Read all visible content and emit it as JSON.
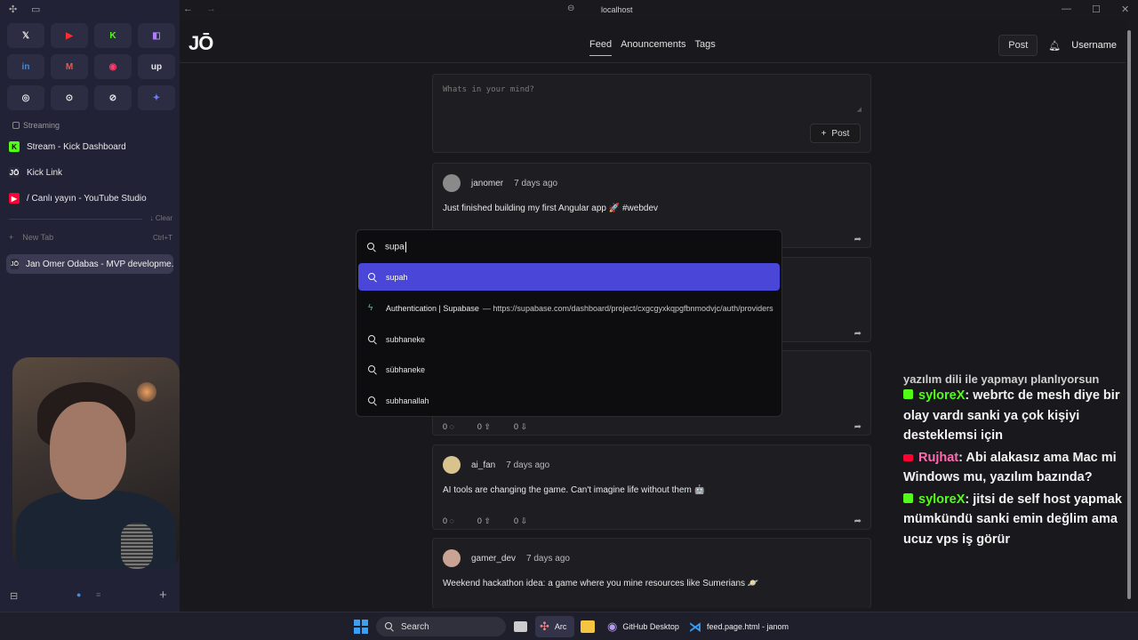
{
  "window": {
    "address": "localhost"
  },
  "sidebar": {
    "favorites": [
      {
        "glyph": "𝕏",
        "color": "#e8e8e8",
        "icon": "x-twitter-icon"
      },
      {
        "glyph": "▶",
        "color": "#ff2d2d",
        "icon": "youtube-icon"
      },
      {
        "glyph": "K",
        "color": "#53fc18",
        "icon": "kick-icon"
      },
      {
        "glyph": "◧",
        "color": "#b17bff",
        "icon": "twitch-icon"
      },
      {
        "glyph": "in",
        "color": "#3a8ddf",
        "icon": "linkedin-icon"
      },
      {
        "glyph": "M",
        "color": "#e8584a",
        "icon": "gmail-icon"
      },
      {
        "glyph": "◉",
        "color": "#ff3d6b",
        "icon": "record-icon"
      },
      {
        "glyph": "up",
        "color": "#e8e8e8",
        "icon": "upwork-icon"
      },
      {
        "glyph": "◎",
        "color": "#e8e8e8",
        "icon": "openai-icon"
      },
      {
        "glyph": "⊙",
        "color": "#e8e8e8",
        "icon": "circle-app-icon"
      },
      {
        "glyph": "⊘",
        "color": "#e8e8e8",
        "icon": "sync-app-icon"
      },
      {
        "glyph": "✦",
        "color": "#6f7bff",
        "icon": "gemini-icon"
      }
    ],
    "section_label": "Streaming",
    "pinned": [
      {
        "label": "Stream - Kick Dashboard",
        "icon": "kick-icon",
        "glyph": "K",
        "bg": "#53fc18",
        "fg": "#000"
      },
      {
        "label": "Kick Link",
        "icon": "jo-logo-icon",
        "glyph": "JŌ",
        "bg": "#2b2b3e",
        "fg": "#fff"
      },
      {
        "label": "/ Canlı yayın - YouTube Studio",
        "icon": "youtube-icon",
        "glyph": "▶",
        "bg": "#ff0033",
        "fg": "#fff"
      }
    ],
    "clear_label": "Clear",
    "new_tab_label": "New Tab",
    "new_tab_shortcut": "Ctrl+T",
    "active_tab": "Jan Omer Odabas - MVP developme..."
  },
  "app": {
    "logo": "JŌ",
    "nav": [
      "Feed",
      "Anouncements",
      "Tags"
    ],
    "post_button": "Post",
    "username": "Username",
    "composer_placeholder": "Whats in your mind?",
    "composer_post": "Post",
    "posts": [
      {
        "user": "janomer",
        "time": "7 days ago",
        "content": "Just finished building my first Angular app 🚀 #webdev",
        "avatar": "#8a8a8a"
      },
      {
        "user": "",
        "time": "",
        "content": "",
        "avatar": "#444"
      },
      {
        "user": "",
        "time": "",
        "content": "",
        "avatar": "#444",
        "likes": "0",
        "up": "0",
        "down": "0"
      },
      {
        "user": "ai_fan",
        "time": "7 days ago",
        "content": "AI tools are changing the game. Can't imagine life without them 🤖",
        "avatar": "#d8c38f",
        "likes": "0",
        "up": "0",
        "down": "0"
      },
      {
        "user": "gamer_dev",
        "time": "7 days ago",
        "content": "Weekend hackathon idea: a game where you mine resources like Sumerians 🪐",
        "avatar": "#c9a394"
      }
    ]
  },
  "chat": {
    "partial": "yazılım dili ile yapmayı planlıyorsun",
    "messages": [
      {
        "platform": "kick",
        "user": "syloreX",
        "text": ": webrtc de mesh diye bir olay vardı sanki ya çok kişiyi desteklemsi için"
      },
      {
        "platform": "youtube",
        "user": "Rujhat",
        "text": ": Abi alakasız ama Mac mi Windows mu, yazılım bazında?"
      },
      {
        "platform": "kick",
        "user": "syloreX",
        "text": ": jitsi de self host yapmak mümkündü sanki emin değlim ama ucuz vps iş görür"
      }
    ]
  },
  "command_bar": {
    "query": "supa",
    "suggestions": [
      {
        "label": "supah",
        "type": "search"
      },
      {
        "label": "Authentication | Supabase",
        "url": "— https://supabase.com/dashboard/project/cxgcgyxkqpgfbnmodvjc/auth/providers",
        "type": "site"
      },
      {
        "label": "subhaneke",
        "type": "search"
      },
      {
        "label": "sübhaneke",
        "type": "search"
      },
      {
        "label": "subhanallah",
        "type": "search"
      }
    ]
  },
  "taskbar": {
    "search": "Search",
    "arc": "Arc",
    "github": "GitHub Desktop",
    "vscode": "feed.page.html - janom"
  }
}
